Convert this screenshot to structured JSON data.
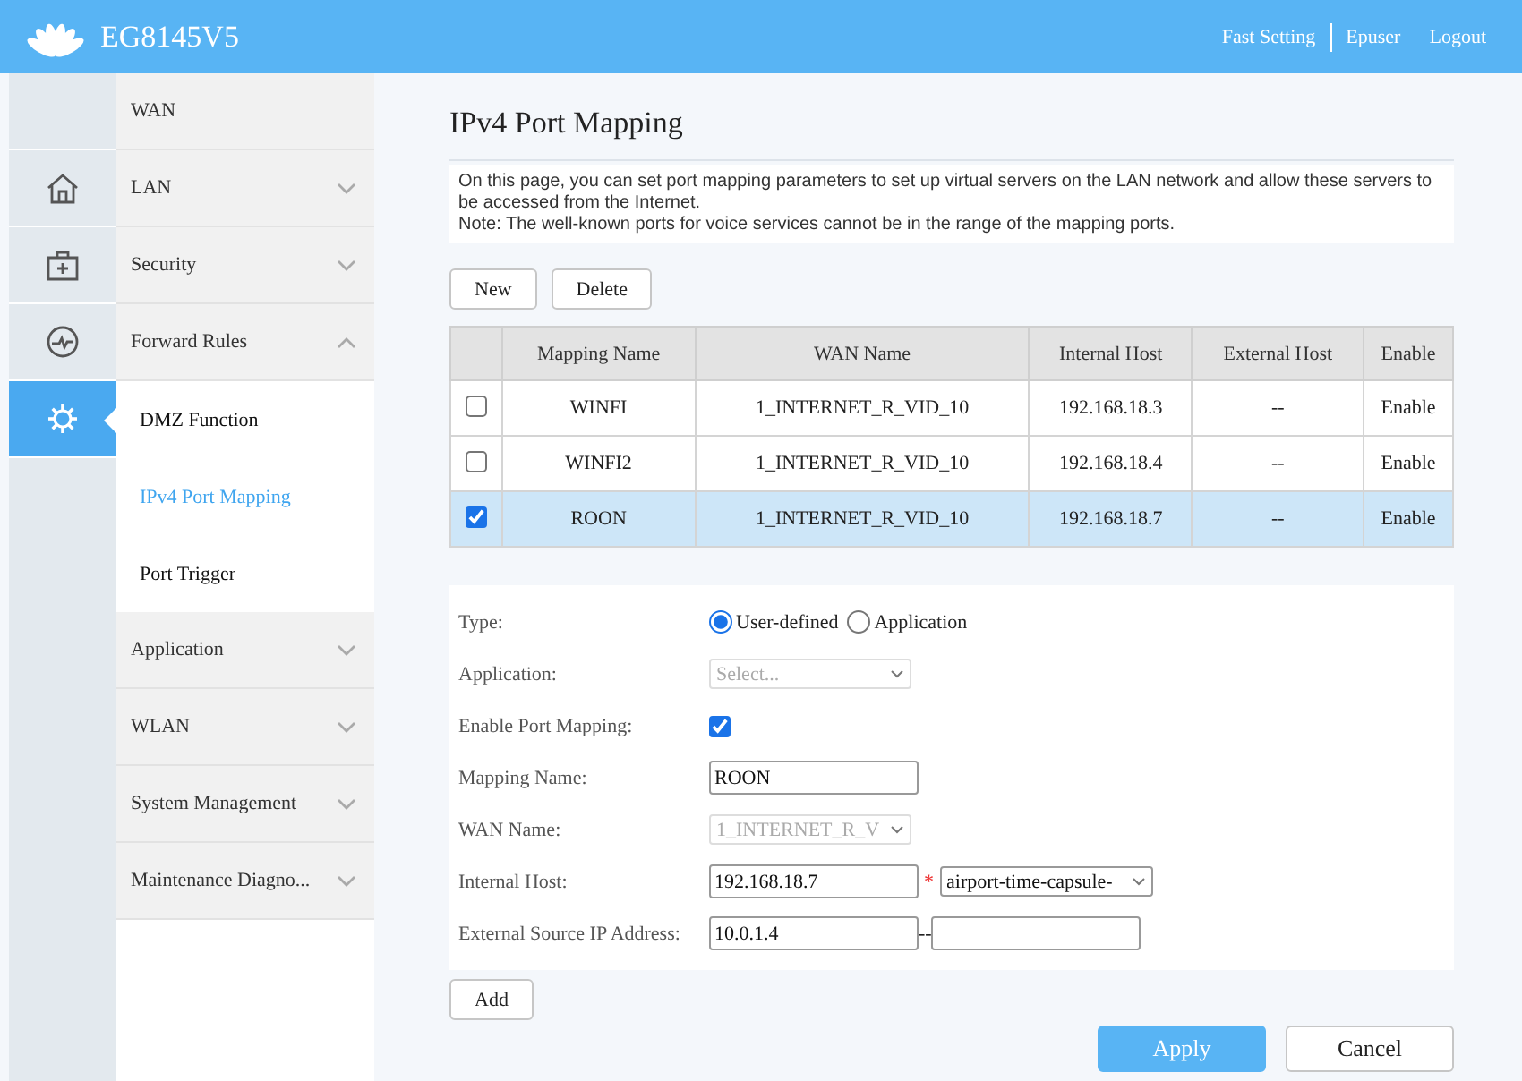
{
  "header": {
    "brand": "EG8145V5",
    "links": [
      "Fast Setting",
      "Epuser",
      "Logout"
    ]
  },
  "rail": [
    {
      "selected": false
    },
    {
      "selected": false
    },
    {
      "selected": false
    },
    {
      "selected": false
    },
    {
      "selected": true
    }
  ],
  "menu": [
    {
      "label": "WAN",
      "kind": "link"
    },
    {
      "label": "LAN",
      "kind": "group",
      "expanded": false
    },
    {
      "label": "Security",
      "kind": "group",
      "expanded": false
    },
    {
      "label": "Forward Rules",
      "kind": "group",
      "expanded": true,
      "children": [
        {
          "label": "DMZ Function",
          "selected": false
        },
        {
          "label": "IPv4 Port Mapping",
          "selected": true
        },
        {
          "label": "Port Trigger",
          "selected": false
        }
      ]
    },
    {
      "label": "Application",
      "kind": "group",
      "expanded": false
    },
    {
      "label": "WLAN",
      "kind": "group",
      "expanded": false
    },
    {
      "label": "System Management",
      "kind": "group",
      "expanded": false
    },
    {
      "label": "Maintenance Diagno...",
      "kind": "group",
      "expanded": false
    }
  ],
  "page": {
    "title": "IPv4 Port Mapping",
    "description": [
      "On this page, you can set port mapping parameters to set up virtual servers on the LAN network and allow these servers to be accessed from the Internet.",
      "Note: The well-known ports for voice services cannot be in the range of the mapping ports."
    ]
  },
  "toolbar": [
    "New",
    "Delete"
  ],
  "table": {
    "columns": [
      "Mapping Name",
      "WAN Name",
      "Internal Host",
      "External Host",
      "Enable"
    ],
    "rows": [
      {
        "checked": false,
        "selected": false,
        "cells": [
          "WINFI",
          "1_INTERNET_R_VID_10",
          "192.168.18.3",
          "--",
          "Enable"
        ]
      },
      {
        "checked": false,
        "selected": false,
        "cells": [
          "WINFI2",
          "1_INTERNET_R_VID_10",
          "192.168.18.4",
          "--",
          "Enable"
        ]
      },
      {
        "checked": true,
        "selected": true,
        "cells": [
          "ROON",
          "1_INTERNET_R_VID_10",
          "192.168.18.7",
          "--",
          "Enable"
        ]
      }
    ]
  },
  "form": [
    {
      "kind": "radio",
      "label": "Type:",
      "options": [
        {
          "label": "User-defined",
          "selected": true
        },
        {
          "label": "Application",
          "selected": false
        }
      ]
    },
    {
      "kind": "select",
      "label": "Application:",
      "value": "Select...",
      "disabled": true
    },
    {
      "kind": "checkbox",
      "label": "Enable Port Mapping:",
      "checked": true
    },
    {
      "kind": "text",
      "label": "Mapping Name:",
      "value": "ROON"
    },
    {
      "kind": "select",
      "label": "WAN Name:",
      "value": "1_INTERNET_R_V",
      "disabled": true
    },
    {
      "kind": "host",
      "label": "Internal Host:",
      "value": "192.168.18.7",
      "required": "*",
      "option": "airport-time-capsule-"
    },
    {
      "kind": "range",
      "label": "External Source IP Address:",
      "value": "10.0.1.4",
      "separator": "--"
    }
  ],
  "add_button": "Add",
  "actions": [
    {
      "label": "Apply",
      "primary": true
    },
    {
      "label": "Cancel",
      "primary": false
    }
  ]
}
